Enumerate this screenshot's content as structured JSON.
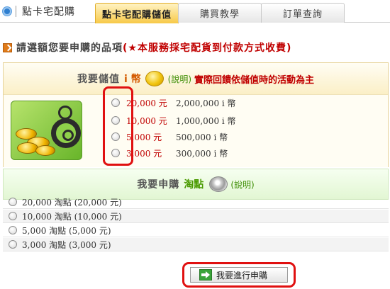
{
  "header": {
    "title": "點卡宅配購",
    "tabs": [
      {
        "label": "點卡宅配購儲值",
        "active": true
      },
      {
        "label": "購買教學",
        "active": false
      },
      {
        "label": "訂單查詢",
        "active": false
      }
    ]
  },
  "instruction": {
    "text": "請選額您要申購的品項",
    "note": "(★本服務採宅配貨到付款方式收費)"
  },
  "ipoint": {
    "heading": "我要儲值",
    "currency": "i 幣",
    "explain": "(說明)",
    "notice": "實際回饋依儲值時的活動為主",
    "options": [
      {
        "price": "20,000 元",
        "amount": "2,000,000  i 幣"
      },
      {
        "price": "10,000 元",
        "amount": "1,000,000  i 幣"
      },
      {
        "price": "5,000 元",
        "amount": "500,000  i 幣"
      },
      {
        "price": "3,000 元",
        "amount": "300,000  i 幣"
      }
    ]
  },
  "taopoint": {
    "heading": "我要申購",
    "name": "淘點",
    "explain": "(說明)",
    "options": [
      {
        "label": "20,000 淘點 (20,000 元)"
      },
      {
        "label": "10,000 淘點 (10,000 元)"
      },
      {
        "label": "5,000 淘點 (5,000 元)"
      },
      {
        "label": "3,000 淘點 (3,000 元)"
      }
    ]
  },
  "submit": {
    "label": "我要進行申購"
  },
  "colors": {
    "accent_red": "#e01010",
    "tab_active": "#f7c948",
    "price_red": "#c00000",
    "green": "#4a9a00"
  }
}
